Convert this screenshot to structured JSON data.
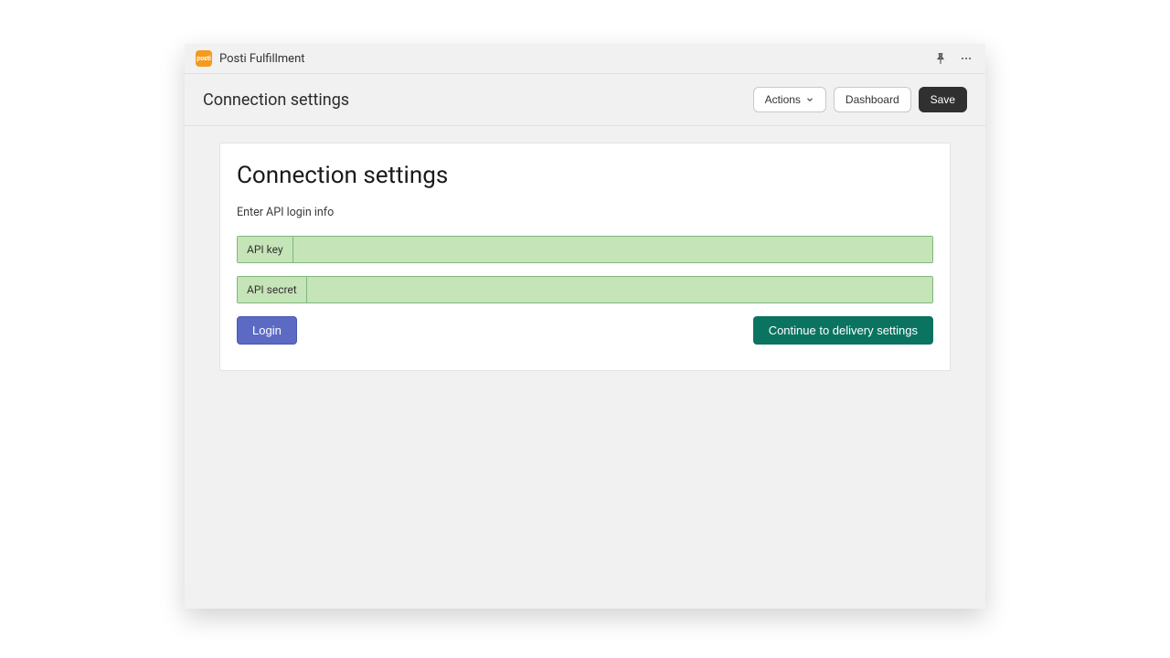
{
  "appIcon": "posti",
  "appTitle": "Posti Fulfillment",
  "toolbar": {
    "title": "Connection settings",
    "actions": "Actions",
    "dashboard": "Dashboard",
    "save": "Save"
  },
  "card": {
    "heading": "Connection settings",
    "subtext": "Enter API login info",
    "apiKeyLabel": "API key",
    "apiKeyValue": "",
    "apiSecretLabel": "API secret",
    "apiSecretValue": "",
    "loginLabel": "Login",
    "continueLabel": "Continue to delivery settings"
  }
}
